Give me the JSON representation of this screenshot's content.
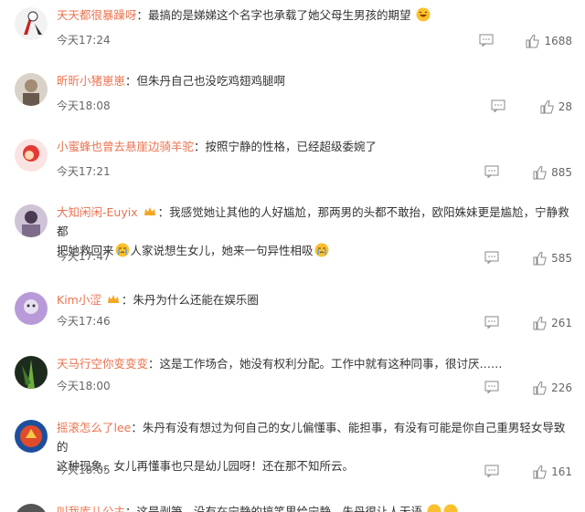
{
  "comments": [
    {
      "user": "天天都很暴躁呀",
      "text": "最搞的是娣娣这个名字也承载了她父母生男孩的期望",
      "time": "今天17:24",
      "likes": "1688"
    },
    {
      "user": "昕昕小猪崽崽",
      "text": "但朱丹自己也没吃鸡翅鸡腿啊",
      "time": "今天18:08",
      "likes": "28"
    },
    {
      "user": "小蜜蜂也曾去悬崖边骑羊驼",
      "text": "按照宁静的性格，已经超级委婉了",
      "time": "今天17:21",
      "likes": "885"
    },
    {
      "user": "大知闲闲-Euyix",
      "text1": "我感觉她让其他的人好尴尬，那两男的头都不敢抬，欧阳姝妹更是尴尬，宁静救都",
      "text2": "把她救回来",
      "text3": "人家说想生女儿，她来一句异性相吸",
      "time": "今天17:47",
      "likes": "585"
    },
    {
      "user": "Kim小涩",
      "text": "朱丹为什么还能在娱乐圈",
      "time": "今天17:46",
      "likes": "261"
    },
    {
      "user": "天马行空你变变变",
      "text": "这是工作场合，她没有权利分配。工作中就有这种同事，很讨厌……",
      "time": "今天18:00",
      "likes": "226"
    },
    {
      "user": "摇滚怎么了lee",
      "text1": "朱丹有没有想过为何自己的女儿偏懂事、能担事，有没有可能是你自己重男轻女导致的",
      "text2": "这种现象，女儿再懂事也只是幼儿园呀！还在那不知所云。",
      "time": "今天18:05",
      "likes": "161"
    },
    {
      "user": "叫我库儿公主",
      "text": "这是剥笋，没有在宁静的搞笑里给宁静，朱丹很让人无语"
    }
  ]
}
